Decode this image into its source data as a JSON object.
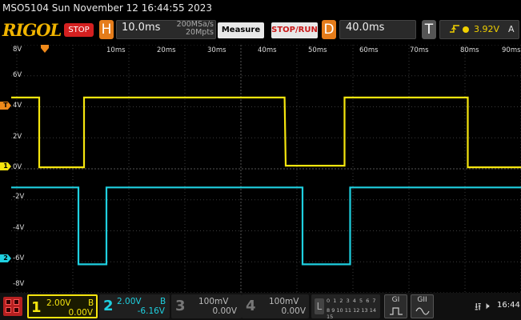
{
  "title_bar": {
    "text": "MSO5104  Sun November 12 16:44:55 2023"
  },
  "toolbar": {
    "logo": "RIGOL",
    "run_state": "STOP",
    "horizontal_letter": "H",
    "timebase": "10.0ms",
    "sample_rate": "200MSa/s",
    "memory_depth": "20Mpts",
    "measure_label": "Measure",
    "stoprun_label": "STOP/RUN",
    "delay_letter": "D",
    "delay": "40.0ms",
    "trigger_letter": "T",
    "trigger_icon": "rising-edge-icon",
    "trigger_level": "3.92V",
    "trigger_mode": "A"
  },
  "scope": {
    "x_ticks": [
      "10ms",
      "20ms",
      "30ms",
      "40ms",
      "50ms",
      "60ms",
      "70ms",
      "80ms",
      "90ms"
    ],
    "y_ticks": [
      "8V",
      "6V",
      "4V",
      "2V",
      "0V",
      "-2V",
      "-4V",
      "-6V",
      "-8V"
    ],
    "marker_trigger": "T",
    "marker_ch1": "1",
    "marker_ch2": "2",
    "colors": {
      "ch1": "#f5e50e",
      "ch2": "#1fd0e0",
      "trigger": "#f08a1a",
      "grid": "#3a3a3a"
    }
  },
  "chart_data": {
    "type": "line",
    "x_unit": "ms",
    "y_unit": "V",
    "xlim": [
      -1,
      90
    ],
    "ylim": [
      -8,
      8
    ],
    "series": [
      {
        "name": "1",
        "color": "#f5e50e",
        "points": [
          [
            -1,
            4.6
          ],
          [
            4,
            4.6
          ],
          [
            4,
            0.1
          ],
          [
            12,
            0.1
          ],
          [
            12,
            4.6
          ],
          [
            47.8,
            4.6
          ],
          [
            48,
            0.2
          ],
          [
            58.5,
            0.2
          ],
          [
            58.5,
            4.6
          ],
          [
            80.5,
            4.6
          ],
          [
            80.5,
            0.1
          ],
          [
            90,
            0.1
          ]
        ]
      },
      {
        "name": "2",
        "color": "#1fd0e0",
        "points": [
          [
            -1,
            -1.2
          ],
          [
            11,
            -1.2
          ],
          [
            11,
            -6.16
          ],
          [
            16,
            -6.16
          ],
          [
            16,
            -1.2
          ],
          [
            51,
            -1.2
          ],
          [
            51,
            -6.16
          ],
          [
            59.5,
            -6.16
          ],
          [
            59.5,
            -1.2
          ],
          [
            90,
            -1.2
          ]
        ]
      }
    ],
    "trigger_position_ms": 5,
    "trigger_level_v": 3.92
  },
  "bottom": {
    "ch1": {
      "num": "1",
      "scale": "2.00V",
      "offset": "0.00V",
      "bw": "B"
    },
    "ch2": {
      "num": "2",
      "scale": "2.00V",
      "offset": "-6.16V",
      "bw": "B"
    },
    "ch3": {
      "num": "3",
      "scale": "100mV",
      "offset": "0.00V"
    },
    "ch4": {
      "num": "4",
      "scale": "100mV",
      "offset": "0.00V"
    },
    "la": {
      "letter": "L",
      "row1": "0 1 2 3 4 5 6 7",
      "row2": "8 9 10 11 12 13 14 15"
    },
    "gen1": "GI",
    "gen2": "GII",
    "clock": "16:44"
  }
}
